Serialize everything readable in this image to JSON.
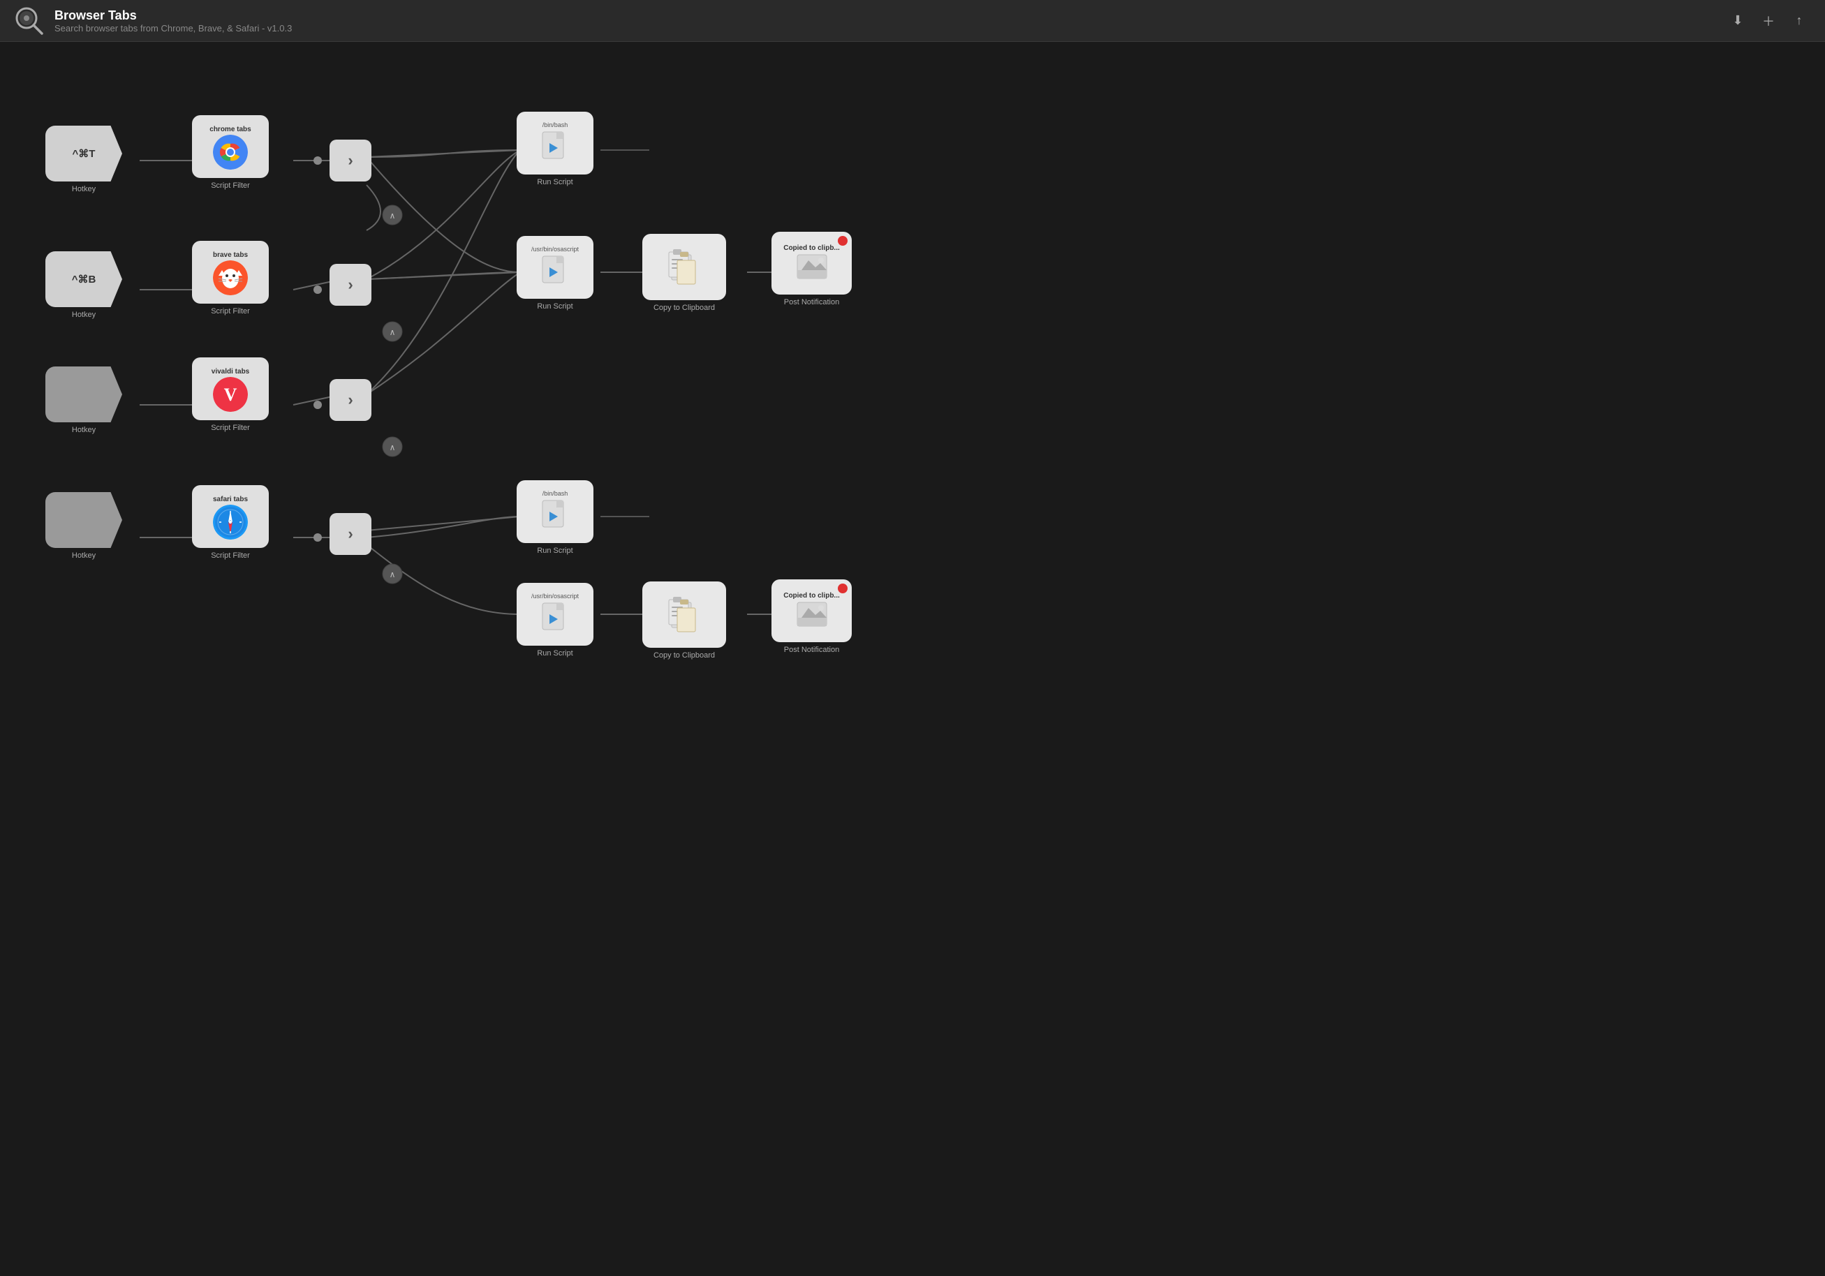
{
  "header": {
    "title": "Browser Tabs",
    "subtitle": "Search browser tabs from Chrome, Brave, & Safari - v1.0.3",
    "icon": "🔍",
    "actions": [
      "import-icon",
      "export-icon",
      "share-icon"
    ]
  },
  "nodes": {
    "hotkeys": [
      {
        "id": "hk1",
        "label": "^⌘T",
        "sublabel": "Hotkey",
        "empty": false
      },
      {
        "id": "hk2",
        "label": "^⌘B",
        "sublabel": "Hotkey",
        "empty": false
      },
      {
        "id": "hk3",
        "label": "",
        "sublabel": "Hotkey",
        "empty": true
      },
      {
        "id": "hk4",
        "label": "",
        "sublabel": "Hotkey",
        "empty": true
      }
    ],
    "scriptFilters": [
      {
        "id": "sf1",
        "title": "chrome tabs",
        "sublabel": "Script Filter",
        "browser": "chrome"
      },
      {
        "id": "sf2",
        "title": "brave tabs",
        "sublabel": "Script Filter",
        "browser": "brave"
      },
      {
        "id": "sf3",
        "title": "vivaldi tabs",
        "sublabel": "Script Filter",
        "browser": "vivaldi"
      },
      {
        "id": "sf4",
        "title": "safari tabs",
        "sublabel": "Script Filter",
        "browser": "safari"
      }
    ],
    "runScripts": [
      {
        "id": "rs1",
        "path": "/bin/bash",
        "label": "Run Script"
      },
      {
        "id": "rs2",
        "path": "/usr/bin/osascript",
        "label": "Run Script"
      },
      {
        "id": "rs3",
        "path": "/bin/bash",
        "label": "Run Script"
      },
      {
        "id": "rs4",
        "path": "/usr/bin/osascript",
        "label": "Run Script"
      }
    ],
    "copyToClipboard": [
      {
        "id": "c1",
        "label": "Copy to Clipboard"
      },
      {
        "id": "c2",
        "label": "Copy to Clipboard"
      }
    ],
    "notifications": [
      {
        "id": "n1",
        "title": "Copied to clipb...",
        "label": "Post Notification"
      },
      {
        "id": "n2",
        "title": "Copied to clipb...",
        "label": "Post Notification"
      }
    ]
  },
  "colors": {
    "bg": "#1a1a1a",
    "header": "#2a2a2a",
    "node_bg": "#e0e0e0",
    "connector": "#888888",
    "line": "#777777"
  }
}
